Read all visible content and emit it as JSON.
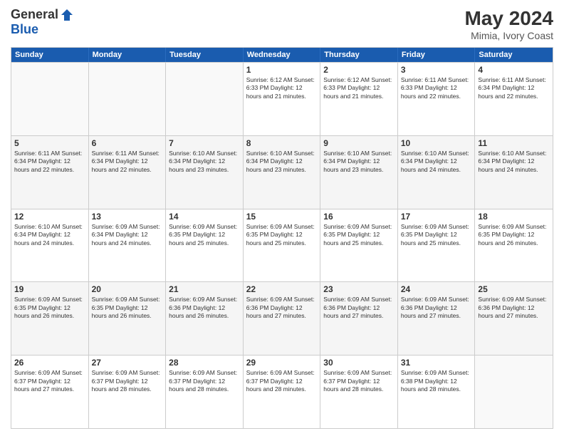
{
  "logo": {
    "general": "General",
    "blue": "Blue"
  },
  "title": {
    "month": "May 2024",
    "location": "Mimia, Ivory Coast"
  },
  "days_of_week": [
    "Sunday",
    "Monday",
    "Tuesday",
    "Wednesday",
    "Thursday",
    "Friday",
    "Saturday"
  ],
  "weeks": [
    [
      {
        "day": "",
        "info": ""
      },
      {
        "day": "",
        "info": ""
      },
      {
        "day": "",
        "info": ""
      },
      {
        "day": "1",
        "info": "Sunrise: 6:12 AM\nSunset: 6:33 PM\nDaylight: 12 hours\nand 21 minutes."
      },
      {
        "day": "2",
        "info": "Sunrise: 6:12 AM\nSunset: 6:33 PM\nDaylight: 12 hours\nand 21 minutes."
      },
      {
        "day": "3",
        "info": "Sunrise: 6:11 AM\nSunset: 6:33 PM\nDaylight: 12 hours\nand 22 minutes."
      },
      {
        "day": "4",
        "info": "Sunrise: 6:11 AM\nSunset: 6:34 PM\nDaylight: 12 hours\nand 22 minutes."
      }
    ],
    [
      {
        "day": "5",
        "info": "Sunrise: 6:11 AM\nSunset: 6:34 PM\nDaylight: 12 hours\nand 22 minutes."
      },
      {
        "day": "6",
        "info": "Sunrise: 6:11 AM\nSunset: 6:34 PM\nDaylight: 12 hours\nand 22 minutes."
      },
      {
        "day": "7",
        "info": "Sunrise: 6:10 AM\nSunset: 6:34 PM\nDaylight: 12 hours\nand 23 minutes."
      },
      {
        "day": "8",
        "info": "Sunrise: 6:10 AM\nSunset: 6:34 PM\nDaylight: 12 hours\nand 23 minutes."
      },
      {
        "day": "9",
        "info": "Sunrise: 6:10 AM\nSunset: 6:34 PM\nDaylight: 12 hours\nand 23 minutes."
      },
      {
        "day": "10",
        "info": "Sunrise: 6:10 AM\nSunset: 6:34 PM\nDaylight: 12 hours\nand 24 minutes."
      },
      {
        "day": "11",
        "info": "Sunrise: 6:10 AM\nSunset: 6:34 PM\nDaylight: 12 hours\nand 24 minutes."
      }
    ],
    [
      {
        "day": "12",
        "info": "Sunrise: 6:10 AM\nSunset: 6:34 PM\nDaylight: 12 hours\nand 24 minutes."
      },
      {
        "day": "13",
        "info": "Sunrise: 6:09 AM\nSunset: 6:34 PM\nDaylight: 12 hours\nand 24 minutes."
      },
      {
        "day": "14",
        "info": "Sunrise: 6:09 AM\nSunset: 6:35 PM\nDaylight: 12 hours\nand 25 minutes."
      },
      {
        "day": "15",
        "info": "Sunrise: 6:09 AM\nSunset: 6:35 PM\nDaylight: 12 hours\nand 25 minutes."
      },
      {
        "day": "16",
        "info": "Sunrise: 6:09 AM\nSunset: 6:35 PM\nDaylight: 12 hours\nand 25 minutes."
      },
      {
        "day": "17",
        "info": "Sunrise: 6:09 AM\nSunset: 6:35 PM\nDaylight: 12 hours\nand 25 minutes."
      },
      {
        "day": "18",
        "info": "Sunrise: 6:09 AM\nSunset: 6:35 PM\nDaylight: 12 hours\nand 26 minutes."
      }
    ],
    [
      {
        "day": "19",
        "info": "Sunrise: 6:09 AM\nSunset: 6:35 PM\nDaylight: 12 hours\nand 26 minutes."
      },
      {
        "day": "20",
        "info": "Sunrise: 6:09 AM\nSunset: 6:35 PM\nDaylight: 12 hours\nand 26 minutes."
      },
      {
        "day": "21",
        "info": "Sunrise: 6:09 AM\nSunset: 6:36 PM\nDaylight: 12 hours\nand 26 minutes."
      },
      {
        "day": "22",
        "info": "Sunrise: 6:09 AM\nSunset: 6:36 PM\nDaylight: 12 hours\nand 27 minutes."
      },
      {
        "day": "23",
        "info": "Sunrise: 6:09 AM\nSunset: 6:36 PM\nDaylight: 12 hours\nand 27 minutes."
      },
      {
        "day": "24",
        "info": "Sunrise: 6:09 AM\nSunset: 6:36 PM\nDaylight: 12 hours\nand 27 minutes."
      },
      {
        "day": "25",
        "info": "Sunrise: 6:09 AM\nSunset: 6:36 PM\nDaylight: 12 hours\nand 27 minutes."
      }
    ],
    [
      {
        "day": "26",
        "info": "Sunrise: 6:09 AM\nSunset: 6:37 PM\nDaylight: 12 hours\nand 27 minutes."
      },
      {
        "day": "27",
        "info": "Sunrise: 6:09 AM\nSunset: 6:37 PM\nDaylight: 12 hours\nand 28 minutes."
      },
      {
        "day": "28",
        "info": "Sunrise: 6:09 AM\nSunset: 6:37 PM\nDaylight: 12 hours\nand 28 minutes."
      },
      {
        "day": "29",
        "info": "Sunrise: 6:09 AM\nSunset: 6:37 PM\nDaylight: 12 hours\nand 28 minutes."
      },
      {
        "day": "30",
        "info": "Sunrise: 6:09 AM\nSunset: 6:37 PM\nDaylight: 12 hours\nand 28 minutes."
      },
      {
        "day": "31",
        "info": "Sunrise: 6:09 AM\nSunset: 6:38 PM\nDaylight: 12 hours\nand 28 minutes."
      },
      {
        "day": "",
        "info": ""
      }
    ]
  ]
}
